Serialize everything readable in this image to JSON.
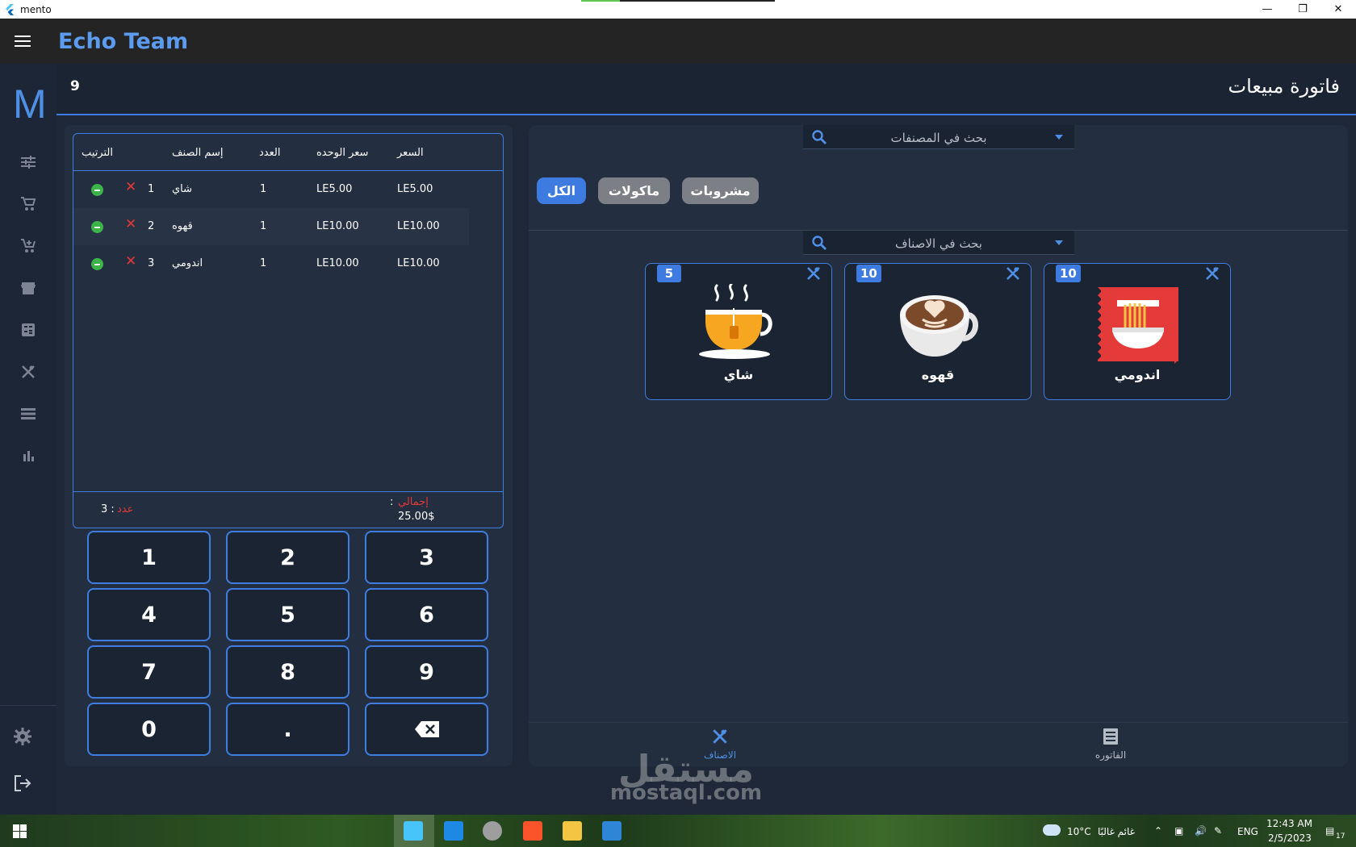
{
  "window": {
    "title": "mento"
  },
  "appbar": {
    "brand": "Echo Team"
  },
  "rail": {
    "logo": "M",
    "items": [
      "tune-icon",
      "cart-icon",
      "cart-add-icon",
      "store-icon",
      "calculator-icon",
      "restaurant-icon",
      "list-icon",
      "bar-chart-icon",
      "settings-icon",
      "logout-icon"
    ]
  },
  "header": {
    "title": "فاتورة مبيعات",
    "count": "9"
  },
  "invoice": {
    "columns": {
      "order": "الترتيب",
      "name": "إسم الصنف",
      "qty": "العدد",
      "unit_price": "سعر الوحده",
      "price": "السعر"
    },
    "rows": [
      {
        "order": "1",
        "name": "شاي",
        "qty": "1",
        "unit_price": "LE5.00",
        "price": "LE5.00"
      },
      {
        "order": "2",
        "name": "قهوه",
        "qty": "1",
        "unit_price": "LE10.00",
        "price": "LE10.00"
      },
      {
        "order": "3",
        "name": "اندومي",
        "qty": "1",
        "unit_price": "LE10.00",
        "price": "LE10.00"
      }
    ],
    "total_label": "إجمالي",
    "total_colon": ":",
    "total_value": "25.00$",
    "count_label": "عدد",
    "count_value": "3 :"
  },
  "keypad": {
    "keys": [
      "1",
      "2",
      "3",
      "4",
      "5",
      "6",
      "7",
      "8",
      "9",
      "0",
      ".",
      "backspace"
    ]
  },
  "catalog": {
    "category_search_placeholder": "بحث في المصنفات",
    "item_search_placeholder": "بحث في الاصناف",
    "chips": [
      {
        "label": "الكل",
        "active": true
      },
      {
        "label": "ماكولات",
        "active": false
      },
      {
        "label": "مشروبات",
        "active": false
      }
    ],
    "items": [
      {
        "name": "شاي",
        "badge": "5",
        "image": "tea-cup-icon"
      },
      {
        "name": "قهوه",
        "badge": "10",
        "image": "coffee-cup-icon"
      },
      {
        "name": "اندومي",
        "badge": "10",
        "image": "noodles-pack-icon"
      }
    ]
  },
  "bottom_nav": {
    "items_label": "الاصناف",
    "invoice_label": "الفاتوره"
  },
  "watermark": {
    "arabic": "مستقل",
    "latin": "mostaql.com"
  },
  "taskbar": {
    "weather": "10°C",
    "weather_text": "غائم غالبًا",
    "lang": "ENG",
    "time": "12:43 AM",
    "date": "2/5/2023",
    "notifications": "17"
  },
  "colors": {
    "accent": "#3d7be0",
    "brand": "#5b9cf0",
    "danger": "#e53935",
    "success": "#3db44a",
    "panel": "#232e40"
  }
}
